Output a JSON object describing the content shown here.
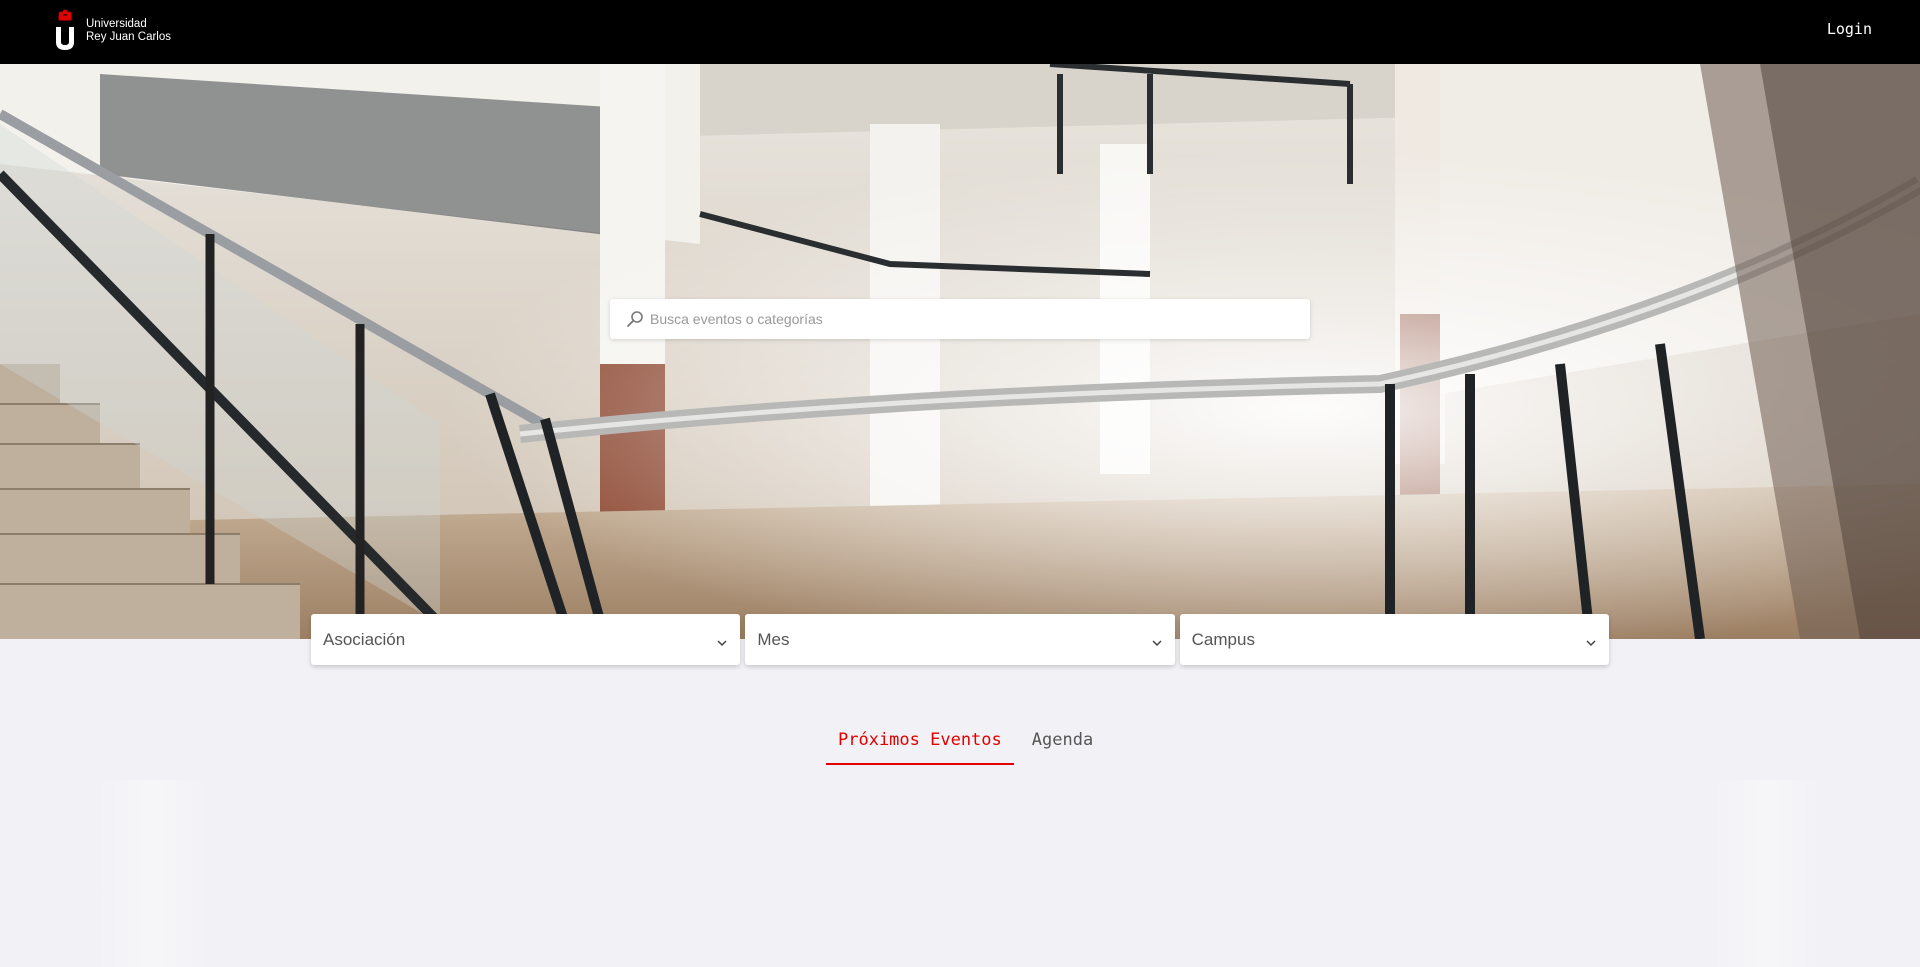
{
  "header": {
    "logo_line1": "Universidad",
    "logo_line2": "Rey Juan Carlos",
    "login_label": "Login"
  },
  "hero": {
    "image": "university-atrium-staircase-photo"
  },
  "search": {
    "placeholder": "Busca eventos o categorías",
    "value": "",
    "icon": "search-icon"
  },
  "filters": [
    {
      "label": "Asociación",
      "icon": "chevron-down-icon"
    },
    {
      "label": "Mes",
      "icon": "chevron-down-icon"
    },
    {
      "label": "Campus",
      "icon": "chevron-down-icon"
    }
  ],
  "tabs": [
    {
      "label": "Próximos Eventos",
      "active": true
    },
    {
      "label": "Agenda",
      "active": false
    }
  ],
  "colors": {
    "accent": "#e00000",
    "header_bg": "#000000",
    "page_bg": "#f2f2f6"
  }
}
